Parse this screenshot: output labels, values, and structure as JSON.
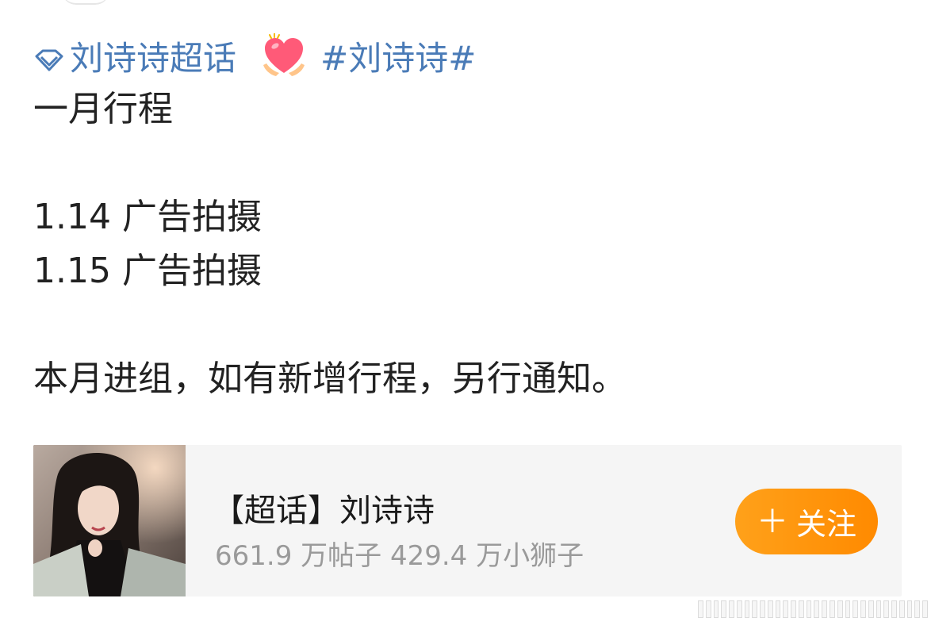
{
  "post": {
    "super_topic_link": "刘诗诗超话",
    "hashtag": "#刘诗诗#",
    "lines": [
      "一月行程",
      "",
      "1.14 广告拍摄",
      "1.15 广告拍摄",
      "",
      "本月进组，如有新增行程，另行通知。"
    ]
  },
  "card": {
    "title": "【超话】刘诗诗",
    "stats": "661.9 万帖子 429.4 万小狮子",
    "follow_label": "关注",
    "follow_icon": "plus-icon",
    "button_color": "#ff9500"
  },
  "colors": {
    "link": "#4a7bb7",
    "text": "#222222",
    "card_bg": "#f5f5f5"
  }
}
